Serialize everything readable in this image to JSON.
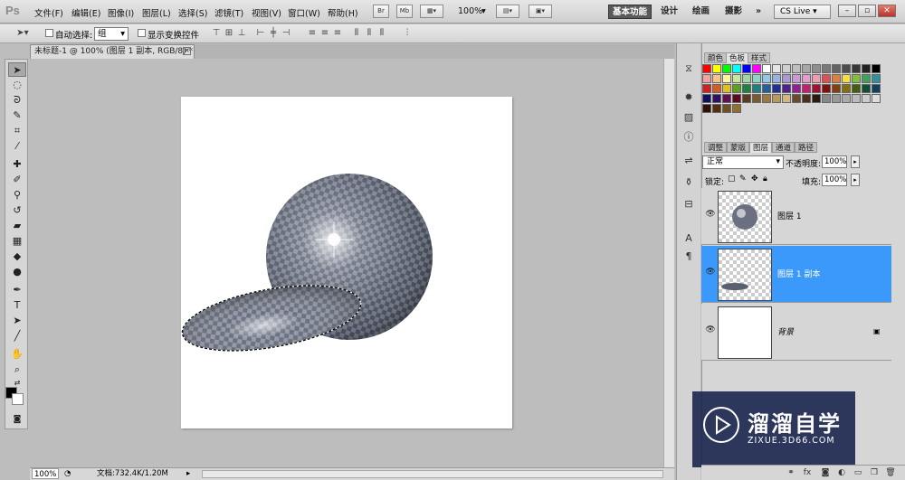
{
  "app": {
    "logo": "Ps"
  },
  "menu": [
    "文件(F)",
    "编辑(E)",
    "图像(I)",
    "图层(L)",
    "选择(S)",
    "滤镜(T)",
    "视图(V)",
    "窗口(W)",
    "帮助(H)"
  ],
  "toolbar": {
    "br_label": "Br",
    "mb_label": "Mb",
    "zoom": "100%"
  },
  "workspace": {
    "active": "基本功能",
    "items": [
      "设计",
      "绘画",
      "摄影"
    ],
    "more": "»"
  },
  "cslive": "CS Live",
  "window_buttons": [
    "–",
    "▫",
    "✕"
  ],
  "options": {
    "auto_select_label": "自动选择:",
    "auto_select_value": "组",
    "show_transform_label": "显示变换控件"
  },
  "document": {
    "tab_title": "未标题-1 @ 100% (图层 1 副本, RGB/8) *"
  },
  "status": {
    "zoom": "100%",
    "doc_info": "文档:732.4K/1.20M"
  },
  "panels": {
    "top_tabs": [
      "颜色",
      "色板",
      "样式"
    ],
    "top_active": "色板",
    "layer_tabs": [
      "调整",
      "蒙版",
      "图层",
      "通道",
      "路径"
    ],
    "layer_active": "图层",
    "blend_mode": "正常",
    "opacity_label": "不透明度:",
    "opacity_value": "100%",
    "lock_label": "锁定:",
    "fill_label": "填充:",
    "fill_value": "100%"
  },
  "layers": [
    {
      "name": "图层 1",
      "selected": false
    },
    {
      "name": "图层 1 副本",
      "selected": true
    },
    {
      "name": "背景",
      "selected": false,
      "locked": true
    }
  ],
  "watermark": {
    "title": "溜溜自学",
    "subtitle": "ZIXUE.3D66.COM"
  },
  "colors": {
    "selection": "#3b99fc",
    "workspace_bg": "#bdbdbd",
    "panel_bg": "#d6d6d6"
  }
}
